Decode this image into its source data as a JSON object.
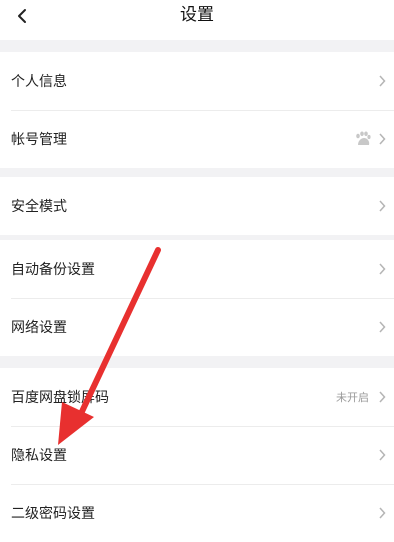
{
  "header": {
    "title": "设置"
  },
  "groups": [
    {
      "items": [
        {
          "label": "个人信息"
        },
        {
          "label": "帐号管理"
        }
      ]
    },
    {
      "items": [
        {
          "label": "安全模式"
        }
      ]
    },
    {
      "items": [
        {
          "label": "自动备份设置"
        },
        {
          "label": "网络设置"
        }
      ]
    },
    {
      "items": [
        {
          "label": "百度网盘锁屏码",
          "status": "未开启"
        },
        {
          "label": "隐私设置"
        },
        {
          "label": "二级密码设置"
        }
      ]
    }
  ],
  "icons": {
    "back": "chevron-left-icon",
    "chevron": "chevron-right-icon",
    "account_badge": "baidu-paw-icon",
    "annotation": "red-arrow"
  },
  "colors": {
    "background": "#f2f2f4",
    "annotation_arrow": "#e8302f",
    "chevron": "#b5b5b5"
  }
}
